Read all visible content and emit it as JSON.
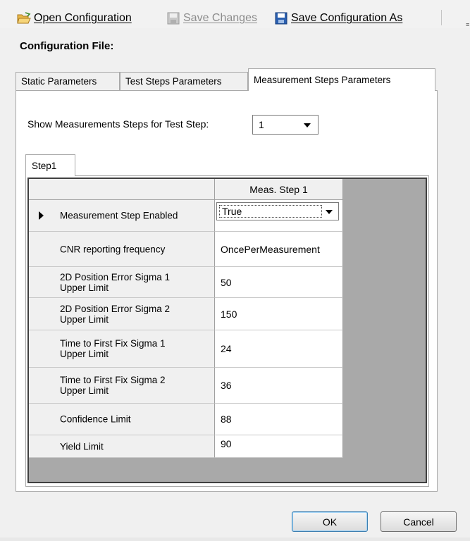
{
  "toolbar": {
    "open_label": "Open Configuration",
    "save_label": "Save Changes",
    "save_as_label": "Save Configuration As"
  },
  "config_file_label": "Configuration File:",
  "tabs": [
    {
      "label": "Static Parameters"
    },
    {
      "label": "Test Steps Parameters"
    },
    {
      "label": "Measurement Steps Parameters"
    }
  ],
  "test_step_selector": {
    "label": "Show Measurements Steps for Test Step:",
    "value": "1"
  },
  "inner_tab_label": "Step1",
  "grid": {
    "column_header": "Meas. Step 1",
    "rows": [
      {
        "label": "Measurement Step Enabled",
        "value": "True"
      },
      {
        "label": "CNR reporting frequency",
        "value": "OncePerMeasurement"
      },
      {
        "label": "2D Position Error Sigma 1 Upper Limit",
        "value": "50"
      },
      {
        "label": "2D Position Error Sigma 2 Upper Limit",
        "value": "150"
      },
      {
        "label": "Time to First Fix Sigma 1 Upper Limit",
        "value": "24"
      },
      {
        "label": "Time to First Fix Sigma 2 Upper Limit",
        "value": "36"
      },
      {
        "label": "Confidence Limit",
        "value": "88"
      },
      {
        "label": "Yield Limit",
        "value": "90"
      }
    ]
  },
  "buttons": {
    "ok": "OK",
    "cancel": "Cancel"
  }
}
